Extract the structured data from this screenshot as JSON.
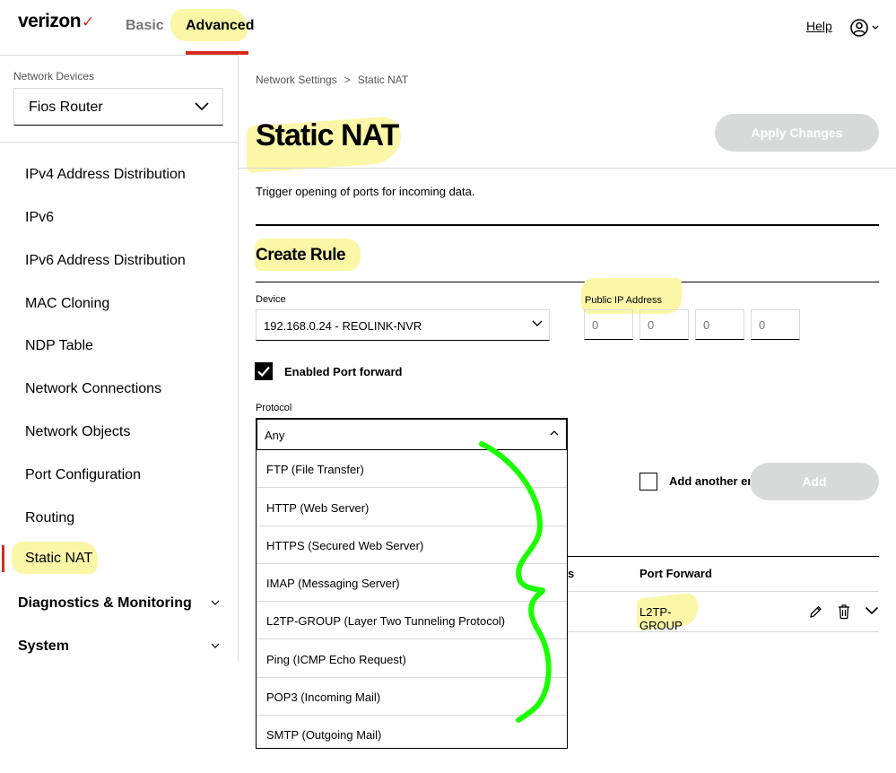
{
  "header": {
    "logo": "verizon",
    "logo_mark": "✓",
    "nav_basic": "Basic",
    "nav_advanced": "Advanced",
    "help": "Help",
    "user_icon": "user-circle-icon"
  },
  "sidebar": {
    "devices_label": "Network Devices",
    "device_selected": "Fios Router",
    "items": [
      {
        "label": "IPv4 Address Distribution"
      },
      {
        "label": "IPv6"
      },
      {
        "label": "IPv6 Address Distribution"
      },
      {
        "label": "MAC Cloning"
      },
      {
        "label": "NDP Table"
      },
      {
        "label": "Network Connections"
      },
      {
        "label": "Network Objects"
      },
      {
        "label": "Port Configuration"
      },
      {
        "label": "Routing"
      },
      {
        "label": "Static NAT"
      }
    ],
    "groups": [
      {
        "label": "Diagnostics & Monitoring"
      },
      {
        "label": "System"
      }
    ]
  },
  "main": {
    "breadcrumb": [
      "Network Settings",
      "Static NAT"
    ],
    "breadcrumb_sep": ">",
    "title": "Static NAT",
    "apply_label": "Apply Changes",
    "description": "Trigger opening of ports for incoming data.",
    "create_rule": {
      "title": "Create Rule",
      "device_label": "Device",
      "device_value": "192.168.0.24 - REOLINK-NVR",
      "public_ip_label": "Public IP Address",
      "public_ip_placeholders": [
        "0",
        "0",
        "0",
        "0"
      ],
      "port_forward_label": "Enabled Port forward",
      "port_forward_checked": true,
      "protocol_label": "Protocol",
      "protocol_value": "Any",
      "protocol_options": [
        "FTP (File Transfer)",
        "HTTP (Web Server)",
        "HTTPS (Secured Web Server)",
        "IMAP (Messaging Server)",
        "L2TP-GROUP (Layer Two Tunneling Protocol)",
        "Ping (ICMP Echo Request)",
        "POP3 (Incoming Mail)",
        "SMTP (Outgoing Mail)"
      ],
      "add_another_label": "Add another er",
      "add_label": "Add"
    },
    "table": {
      "col_partial": "s",
      "col_port_forward": "Port Forward",
      "rows": [
        {
          "port_forward": "L2TP-GROUP"
        }
      ]
    }
  },
  "colors": {
    "brand_red": "#d52b1e",
    "highlight": "#fbf7a7",
    "annotation_green": "#1bff00",
    "disabled_button": "#d8dada"
  }
}
